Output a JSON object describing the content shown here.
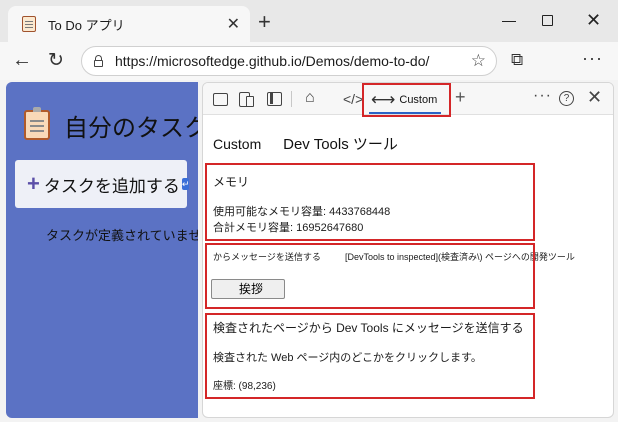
{
  "browser": {
    "tab_title": "To Do アプリ",
    "tab_close": "✕",
    "new_tab": "+",
    "url": "https://microsoftedge.github.io/Demos/demo-to-do/"
  },
  "page": {
    "title": "自分のタスク",
    "add_task_label": "タスクを追加する",
    "empty_message": "タスクが定義されていません"
  },
  "devtools": {
    "custom_tab_label": "Custom",
    "heading": "Custom",
    "heading_sub": "Dev Tools ツール",
    "memory": {
      "title": "メモリ",
      "available_label": "使用可能なメモリ容量: 4433768448",
      "total_label": "合計メモリ容量: 16952647680"
    },
    "send": {
      "label_left": "からメッセージを送信する",
      "label_right": "[DevTools to inspected](検査済み\\) ページへの開発ツール",
      "button_label": "挨拶"
    },
    "receive": {
      "title": "検査されたページから Dev Tools にメッセージを送信する",
      "description": "検査された Web ページ内のどこかをクリックします。",
      "coords": "座標: (98,236)"
    }
  },
  "icons": {
    "tab_favicon": "notepad-icon",
    "back": "back-arrow-icon",
    "refresh": "refresh-icon",
    "lock": "lock-icon",
    "favorite": "star-icon",
    "extensions": "puzzle-icon",
    "menu": "ellipsis-icon"
  },
  "accent": {
    "sidebar_bg": "#5b72c4",
    "highlight_red": "#d42628",
    "tab_underline": "#2b63c6"
  }
}
